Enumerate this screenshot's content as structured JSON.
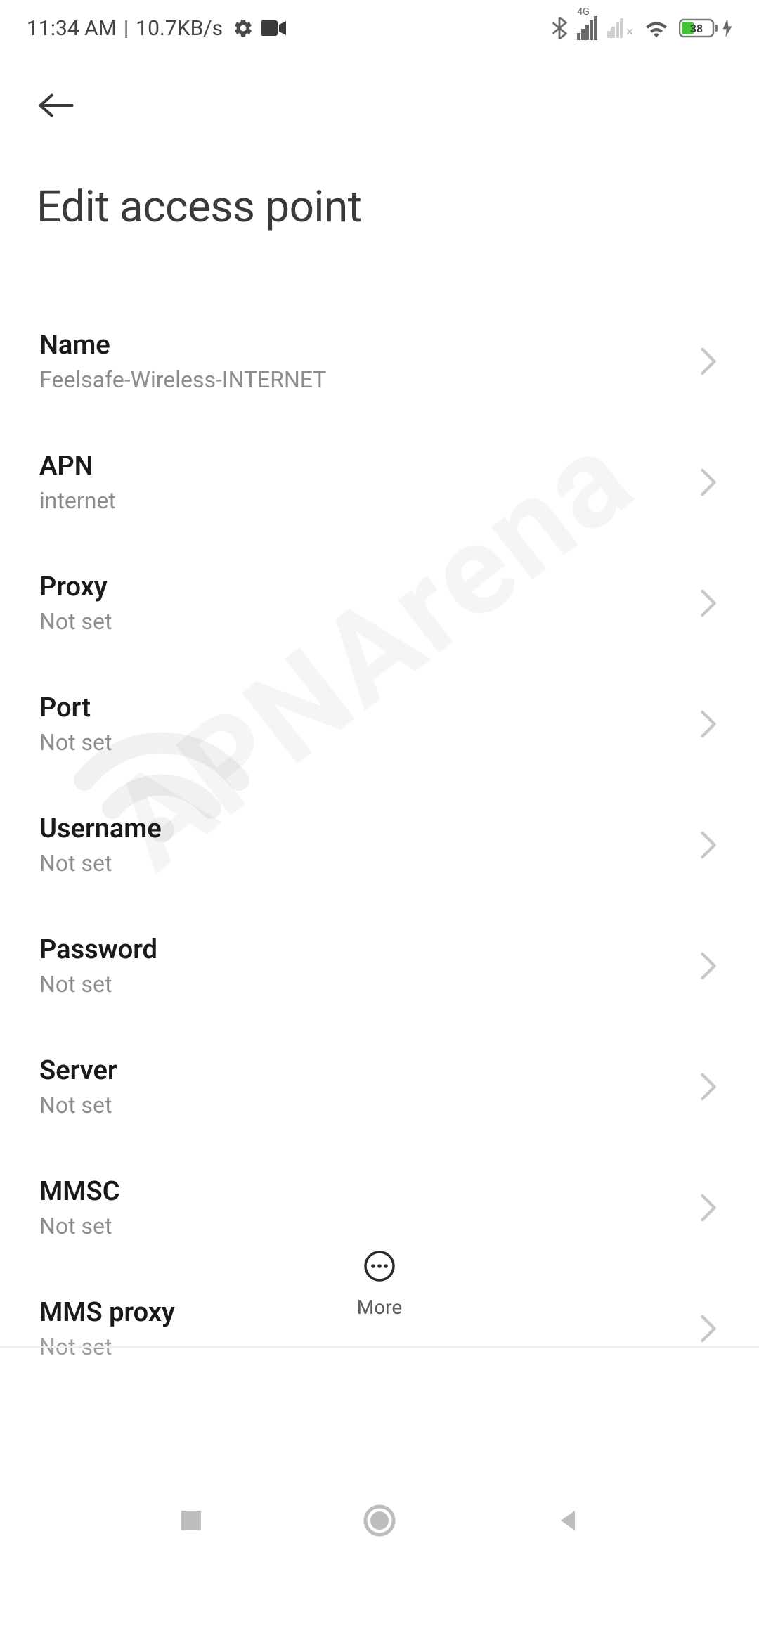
{
  "status": {
    "time": "11:34 AM",
    "separator": " | ",
    "data_rate": "10.7KB/s",
    "battery": "38"
  },
  "header": {
    "title": "Edit access point"
  },
  "settings": [
    {
      "label": "Name",
      "value": "Feelsafe-Wireless-INTERNET"
    },
    {
      "label": "APN",
      "value": "internet"
    },
    {
      "label": "Proxy",
      "value": "Not set"
    },
    {
      "label": "Port",
      "value": "Not set"
    },
    {
      "label": "Username",
      "value": "Not set"
    },
    {
      "label": "Password",
      "value": "Not set"
    },
    {
      "label": "Server",
      "value": "Not set"
    },
    {
      "label": "MMSC",
      "value": "Not set"
    },
    {
      "label": "MMS proxy",
      "value": "Not set"
    }
  ],
  "bottom": {
    "more_label": "More"
  },
  "watermark": "APNArena"
}
